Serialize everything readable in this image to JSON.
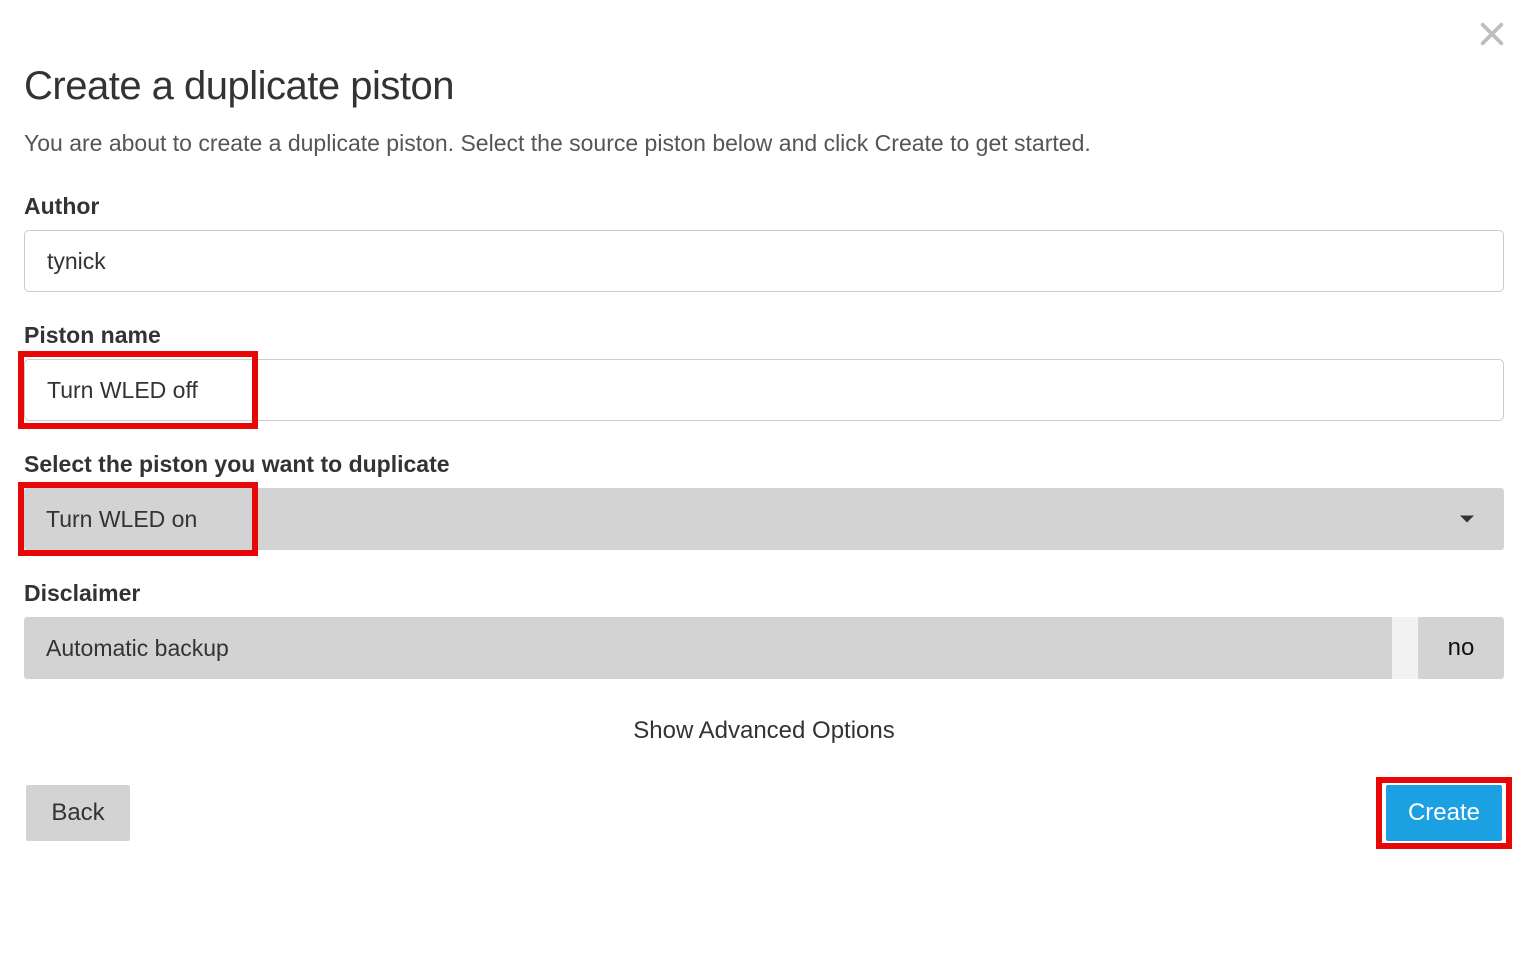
{
  "dialog": {
    "title": "Create a duplicate piston",
    "subtitle": "You are about to create a duplicate piston. Select the source piston below and click Create to get started."
  },
  "fields": {
    "author_label": "Author",
    "author_value": "tynick",
    "piston_name_label": "Piston name",
    "piston_name_value": "Turn WLED off",
    "select_label": "Select the piston you want to duplicate",
    "select_value": "Turn WLED on",
    "disclaimer_label": "Disclaimer",
    "disclaimer_text": "Automatic backup",
    "disclaimer_toggle": "no"
  },
  "links": {
    "advanced": "Show Advanced Options"
  },
  "buttons": {
    "back": "Back",
    "create": "Create"
  }
}
